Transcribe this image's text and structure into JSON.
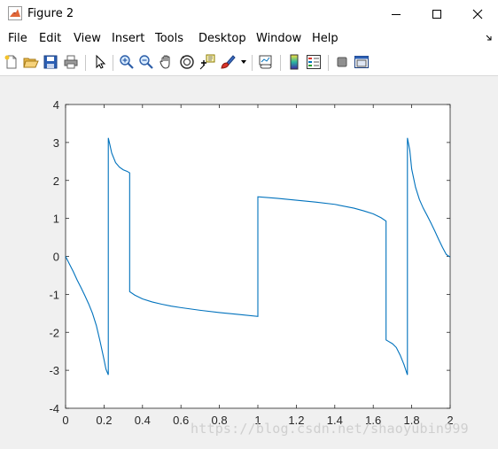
{
  "window": {
    "title": "Figure 2",
    "icon": "matlab-icon",
    "controls": [
      "minimize-icon",
      "maximize-icon",
      "close-icon"
    ]
  },
  "menu": {
    "items": [
      "File",
      "Edit",
      "View",
      "Insert",
      "Tools",
      "Desktop",
      "Window",
      "Help"
    ],
    "overflow_icon": "dock-arrow-icon"
  },
  "toolbar": {
    "buttons": [
      "new-figure-icon",
      "open-file-icon",
      "save-icon",
      "print-icon",
      "pointer-icon",
      "zoom-in-icon",
      "zoom-out-icon",
      "pan-icon",
      "rotate-3d-icon",
      "data-cursor-icon",
      "brush-icon",
      "link-plot-icon",
      "colorbar-icon",
      "legend-icon",
      "hide-plot-tools-icon",
      "show-plot-tools-icon"
    ]
  },
  "watermark": "https://blog.csdn.net/shaoyubin999",
  "colors": {
    "line": "#0072bd",
    "figure_bg": "#f0f0f0",
    "axes_bg": "#ffffff"
  },
  "chart_data": {
    "type": "line",
    "xlim": [
      0,
      2
    ],
    "ylim": [
      -4,
      4
    ],
    "xticks": [
      "0",
      "0.2",
      "0.4",
      "0.6",
      "0.8",
      "1",
      "1.2",
      "1.4",
      "1.6",
      "1.8",
      "2"
    ],
    "yticks": [
      "4",
      "3",
      "2",
      "1",
      "0",
      "-1",
      "-2",
      "-3",
      "-4"
    ],
    "grid": false,
    "series": [
      {
        "color": "#0072bd",
        "x": [
          0,
          0.02,
          0.04,
          0.06,
          0.08,
          0.1,
          0.12,
          0.14,
          0.16,
          0.18,
          0.2,
          0.21,
          0.2222,
          0.2222,
          0.23,
          0.24,
          0.26,
          0.28,
          0.3,
          0.32,
          0.3333,
          0.3333,
          0.36,
          0.4,
          0.45,
          0.5,
          0.55,
          0.6,
          0.7,
          0.8,
          0.9,
          1.0,
          1.0,
          1.1,
          1.2,
          1.3,
          1.4,
          1.5,
          1.55,
          1.6,
          1.64,
          1.6667,
          1.6667,
          1.68,
          1.7,
          1.72,
          1.74,
          1.76,
          1.7778,
          1.7778,
          1.79,
          1.8,
          1.82,
          1.84,
          1.86,
          1.88,
          1.9,
          1.92,
          1.94,
          1.96,
          1.98,
          2.0
        ],
        "y": [
          0,
          -0.2,
          -0.4,
          -0.62,
          -0.82,
          -1.03,
          -1.25,
          -1.5,
          -1.82,
          -2.25,
          -2.72,
          -2.97,
          -3.12,
          3.12,
          2.95,
          2.72,
          2.47,
          2.35,
          2.28,
          2.24,
          2.2,
          -0.93,
          -1.02,
          -1.12,
          -1.2,
          -1.26,
          -1.31,
          -1.35,
          -1.42,
          -1.48,
          -1.53,
          -1.58,
          1.57,
          1.53,
          1.48,
          1.43,
          1.37,
          1.27,
          1.2,
          1.12,
          1.02,
          0.93,
          -2.2,
          -2.24,
          -2.3,
          -2.4,
          -2.6,
          -2.85,
          -3.12,
          3.12,
          2.8,
          2.3,
          1.82,
          1.5,
          1.27,
          1.08,
          0.88,
          0.67,
          0.45,
          0.24,
          0.05,
          -0.02
        ]
      }
    ]
  }
}
